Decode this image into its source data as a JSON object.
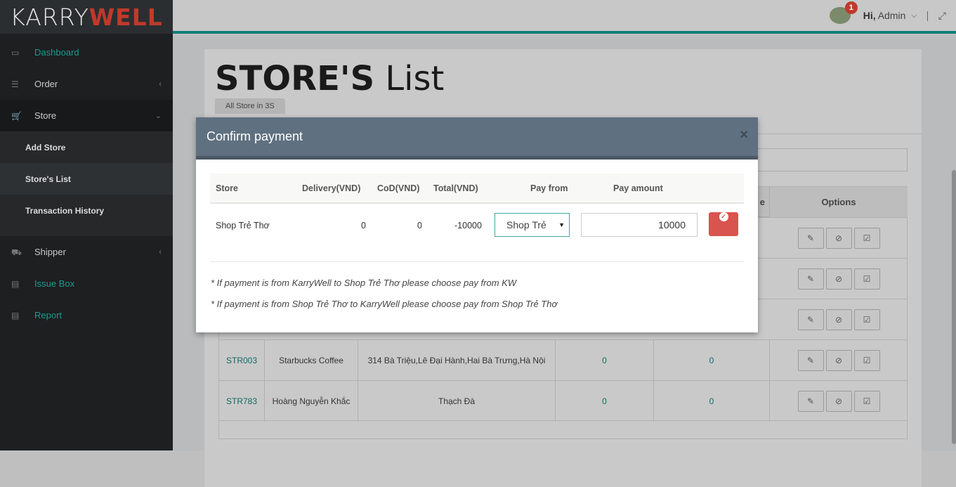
{
  "brand": {
    "part1": "KARRY",
    "part2": "WELL"
  },
  "sidebar": {
    "items": [
      {
        "label": "Dashboard",
        "icon": "laptop-icon"
      },
      {
        "label": "Order",
        "icon": "list-icon"
      },
      {
        "label": "Store",
        "icon": "cart-icon"
      },
      {
        "label": "Shipper",
        "icon": "truck-icon"
      },
      {
        "label": "Issue Box",
        "icon": "book-icon"
      },
      {
        "label": "Report",
        "icon": "book-icon"
      }
    ],
    "store_sub": [
      "Add Store",
      "Store's List",
      "Transaction History"
    ]
  },
  "header": {
    "badge": "1",
    "greeting": "Hi,",
    "user": "Admin"
  },
  "page": {
    "title_bold": "STORE'S",
    "title_rest": "List",
    "tab": "All Store in 3S"
  },
  "table": {
    "options_header": "Options",
    "partial_header": "e",
    "rows": [
      {
        "id": "STR003",
        "name": "Starbucks Coffee",
        "address": "314 Bà Triệu,Lê Đại Hành,Hai Bà Trưng,Hà Nội",
        "v1": "0",
        "v2": "0"
      },
      {
        "id": "STR783",
        "name": "Hoàng Nguyễn Khắc",
        "address": "Thạch Đà",
        "v1": "0",
        "v2": "0"
      }
    ]
  },
  "modal": {
    "title": "Confirm payment",
    "close": "×",
    "headers": {
      "store": "Store",
      "delivery": "Delivery(VND)",
      "cod": "CoD(VND)",
      "total": "Total(VND)",
      "pay_from": "Pay from",
      "pay_amount": "Pay amount"
    },
    "row": {
      "store": "Shop Trẻ Thơ",
      "delivery": "0",
      "cod": "0",
      "total": "-10000",
      "pay_from": "Shop Trẻ",
      "pay_amount": "10000"
    },
    "note1": "* If payment is from KarryWell to Shop Trẻ Thơ please choose pay from KW",
    "note2": "* If payment is from Shop Trẻ Thơ to KarryWell please choose pay from Shop Trẻ Thơ"
  },
  "colors": {
    "accent": "#1a9b8e",
    "danger": "#d9534f",
    "modal_header": "#5f7080"
  }
}
